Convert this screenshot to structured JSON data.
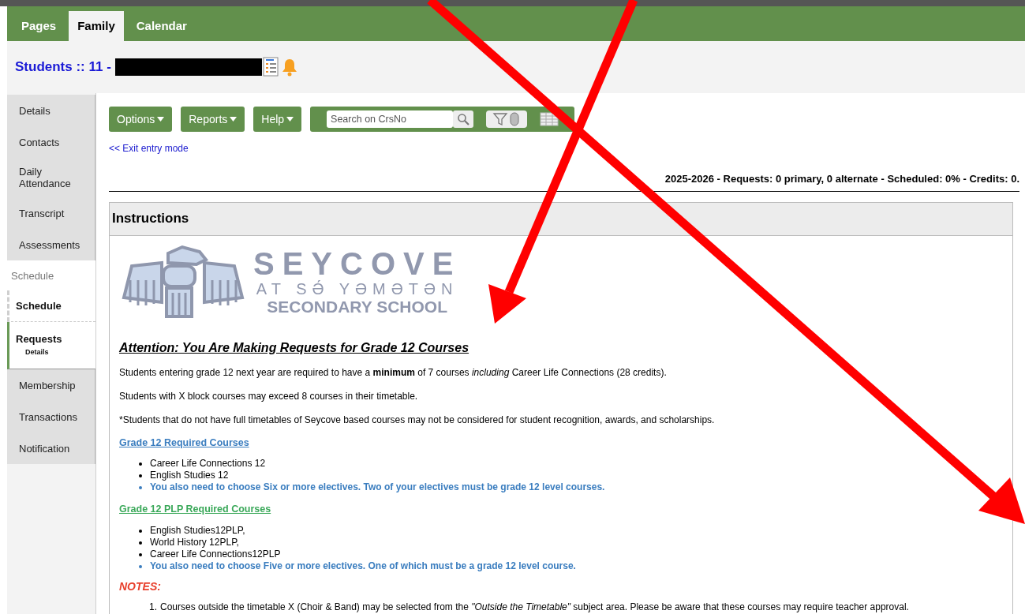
{
  "nav_tabs": [
    {
      "label": "Pages",
      "selected": false
    },
    {
      "label": "Family",
      "selected": true
    },
    {
      "label": "Calendar",
      "selected": false
    }
  ],
  "header": {
    "title": "Students :: 11 -",
    "redacted": true
  },
  "sidebar": {
    "items": [
      {
        "kind": "tab",
        "label": "Details"
      },
      {
        "kind": "tab",
        "label": "Contacts"
      },
      {
        "kind": "tab",
        "label": "Daily Attendance"
      },
      {
        "kind": "tab",
        "label": "Transcript"
      },
      {
        "kind": "tab",
        "label": "Assessments"
      },
      {
        "kind": "section",
        "label": "Schedule"
      },
      {
        "kind": "subtab",
        "label": "Schedule",
        "selected": false
      },
      {
        "kind": "subtab",
        "label": "Requests",
        "sublabel": "Details",
        "selected": true
      },
      {
        "kind": "tab",
        "label": "Membership"
      },
      {
        "kind": "tab",
        "label": "Transactions"
      },
      {
        "kind": "tab",
        "label": "Notification"
      }
    ]
  },
  "toolbar": {
    "menus": [
      "Options",
      "Reports",
      "Help"
    ],
    "search": {
      "placeholder": "Search on CrsNo"
    }
  },
  "exit_link": "<< Exit entry mode",
  "summary": "2025-2026 - Requests: 0 primary, 0 alternate - Scheduled: 0% - Credits: 0.",
  "instructions": {
    "title": "Instructions",
    "logo": {
      "name": "SEYCOVE",
      "subtitle": "AT SƏ́ YƏMƏTƏN",
      "school": "SECONDARY SCHOOL"
    },
    "heading": "Attention: You Are Making Requests for Grade 12 Courses",
    "paragraphs": [
      "Students entering grade 12 next year are required to have a **minimum** of 7 courses *including* Career Life Connections (28 credits).",
      "Students with X block courses may exceed 8 courses in their timetable.",
      "*Students that do not have full timetables of Seycove based courses may not be considered for student recognition, awards, and scholarships."
    ],
    "sections": [
      {
        "title": "Grade 12 Required Courses",
        "color": "#3a7dbf",
        "items": [
          {
            "kind": "plain",
            "text": "Career Life Connections 12"
          },
          {
            "kind": "plain",
            "text": "English Studies 12"
          },
          {
            "kind": "highlight",
            "text": "You also need to choose Six or more electives. Two of your electives must be grade 12 level courses."
          }
        ]
      },
      {
        "title": "Grade 12 PLP Required Courses",
        "color": "#3aa859",
        "items": [
          {
            "kind": "plain",
            "text": "English Studies12PLP,"
          },
          {
            "kind": "plain",
            "text": "World History 12PLP,"
          },
          {
            "kind": "plain",
            "text": "Career Life Connections12PLP"
          },
          {
            "kind": "highlight",
            "text": "You also need to choose Five or more electives. One of which must be a grade 12 level course."
          }
        ]
      }
    ],
    "notes_title": "NOTES:",
    "notes": [
      {
        "number": "1.",
        "text": "Courses outside the timetable X (Choir & Band) may be selected from the *\"Outside the Timetable\"* subject area. Please be aware that these courses may require teacher approval."
      }
    ]
  }
}
